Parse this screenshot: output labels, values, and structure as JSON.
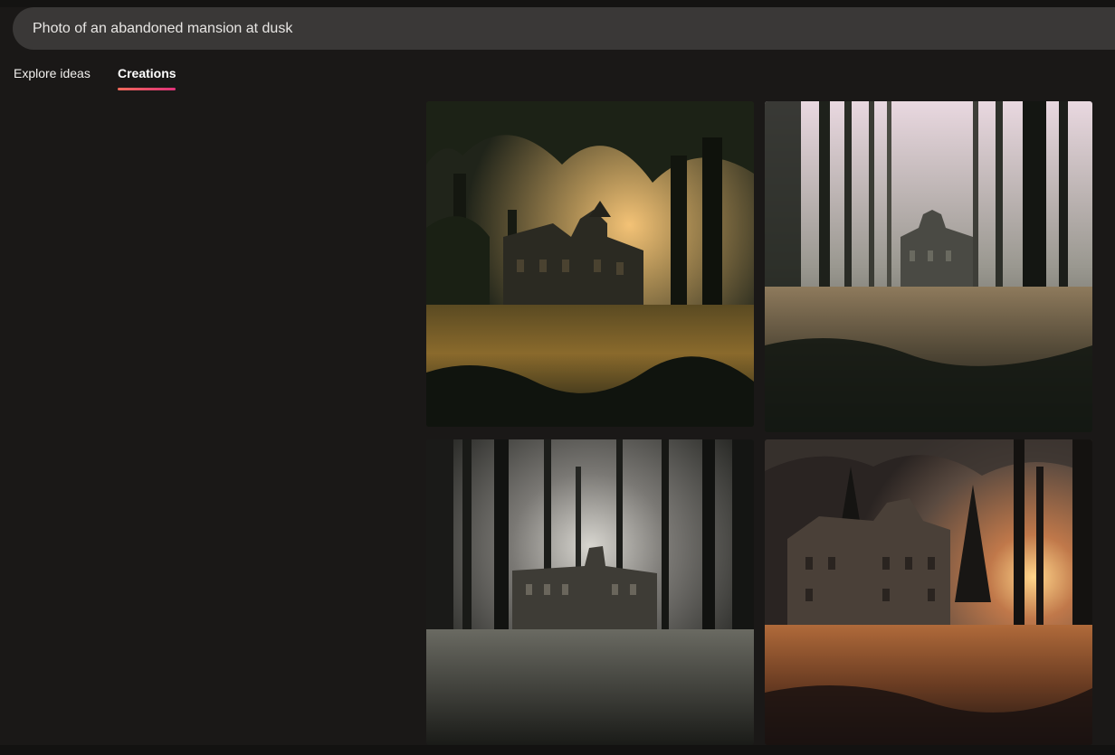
{
  "search": {
    "query": "Photo of an abandoned mansion at dusk"
  },
  "tabs": [
    {
      "label": "Explore ideas",
      "active": false
    },
    {
      "label": "Creations",
      "active": true
    }
  ],
  "colors": {
    "background": "#1a1817",
    "search_bar": "#3a3837",
    "tab_underline_start": "#f06a5a",
    "tab_underline_end": "#e0327a"
  },
  "images": [
    {
      "subject": "mansion-in-forest-golden-sunset"
    },
    {
      "subject": "mansion-in-misty-pine-forest"
    },
    {
      "subject": "mansion-behind-tall-pines-grey-sky"
    },
    {
      "subject": "mansion-with-orange-sunset-grass"
    }
  ]
}
